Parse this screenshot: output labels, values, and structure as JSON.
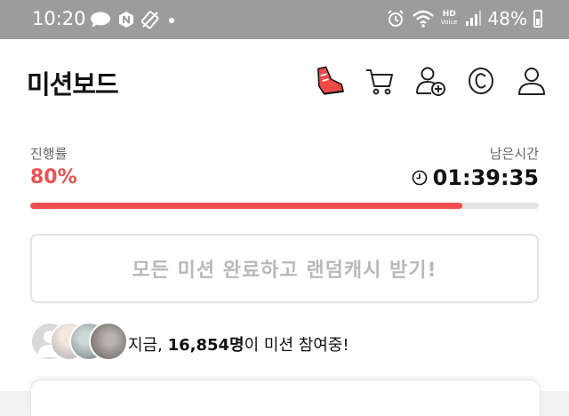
{
  "status_bar": {
    "time": "10:20",
    "hd_label": "HD",
    "voice_label": "Voice",
    "battery": "48%",
    "icons": [
      "message-bubble-icon",
      "naver-icon",
      "no-signal-icon",
      "dot-icon",
      "alarm-icon",
      "wifi-icon",
      "signal-icon",
      "battery-icon"
    ]
  },
  "header": {
    "title": "미션보드",
    "icons": [
      "sneaker-icon",
      "cart-icon",
      "add-friend-icon",
      "cash-coin-icon",
      "profile-icon"
    ],
    "accent": "#e8524f"
  },
  "progress": {
    "label": "진행률",
    "value_text": "80%",
    "fraction": 0.85,
    "bar_color": "#f0504f"
  },
  "timer": {
    "label": "남은시간",
    "value": "01:39:35"
  },
  "reward_button": {
    "label": "모든 미션 완료하고 랜덤캐시 받기!"
  },
  "participants": {
    "prefix": "지금, ",
    "count": "16,854명",
    "suffix": "이 미션 참여중!"
  }
}
